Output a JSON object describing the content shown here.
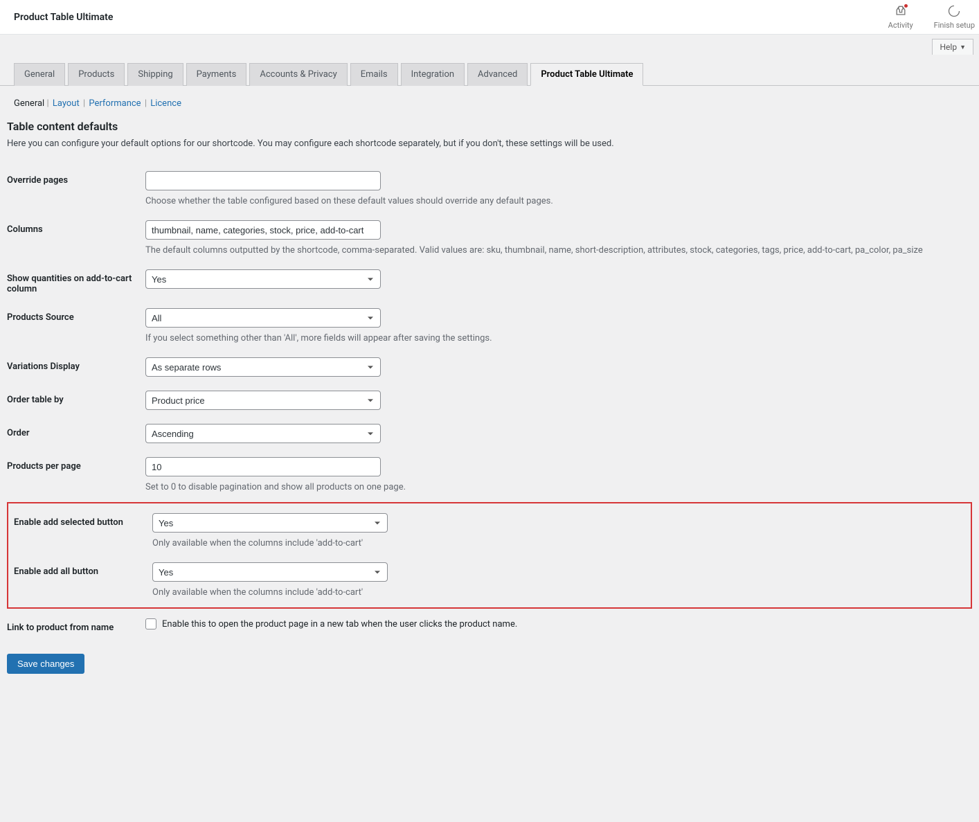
{
  "header": {
    "title": "Product Table Ultimate",
    "activity_label": "Activity",
    "finish_setup_label": "Finish setup",
    "help_label": "Help"
  },
  "tabs": [
    "General",
    "Products",
    "Shipping",
    "Payments",
    "Accounts & Privacy",
    "Emails",
    "Integration",
    "Advanced",
    "Product Table Ultimate"
  ],
  "subnav": {
    "general": "General",
    "layout": "Layout",
    "performance": "Performance",
    "licence": "Licence"
  },
  "section": {
    "title": "Table content defaults",
    "desc": "Here you can configure your default options for our shortcode. You may configure each shortcode separately, but if you don't, these settings will be used."
  },
  "fields": {
    "override_pages": {
      "label": "Override pages",
      "value": "",
      "desc": "Choose whether the table configured based on these default values should override any default pages."
    },
    "columns": {
      "label": "Columns",
      "value": "thumbnail, name, categories, stock, price, add-to-cart",
      "desc": "The default columns outputted by the shortcode, comma-separated. Valid values are: sku, thumbnail, name, short-description, attributes, stock, categories, tags, price, add-to-cart, pa_color, pa_size"
    },
    "show_quantities": {
      "label": "Show quantities on add-to-cart column",
      "value": "Yes"
    },
    "products_source": {
      "label": "Products Source",
      "value": "All",
      "desc": "If you select something other than 'All', more fields will appear after saving the settings."
    },
    "variations_display": {
      "label": "Variations Display",
      "value": "As separate rows"
    },
    "order_by": {
      "label": "Order table by",
      "value": "Product price"
    },
    "order": {
      "label": "Order",
      "value": "Ascending"
    },
    "per_page": {
      "label": "Products per page",
      "value": "10",
      "desc": "Set to 0 to disable pagination and show all products on one page."
    },
    "enable_add_selected": {
      "label": "Enable add selected button",
      "value": "Yes",
      "desc": "Only available when the columns include 'add-to-cart'"
    },
    "enable_add_all": {
      "label": "Enable add all button",
      "value": "Yes",
      "desc": "Only available when the columns include 'add-to-cart'"
    },
    "link_product": {
      "label": "Link to product from name",
      "desc": "Enable this to open the product page in a new tab when the user clicks the product name."
    }
  },
  "save_label": "Save changes"
}
